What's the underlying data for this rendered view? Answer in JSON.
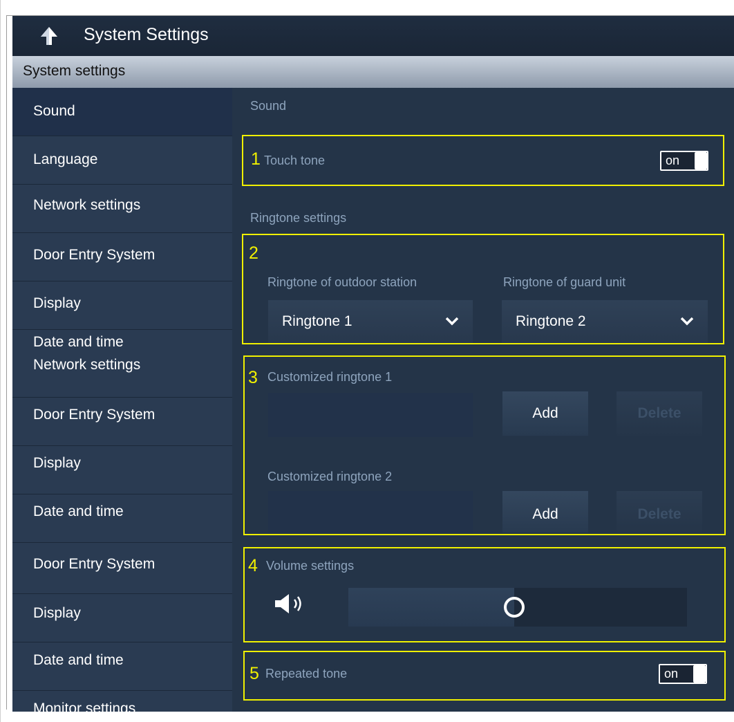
{
  "window": {
    "title": "System Settings"
  },
  "section_header": "System settings",
  "sidebar": {
    "block1": [
      "Sound",
      "Language",
      "Network settings",
      "Door Entry System",
      "Display",
      "Date and time"
    ],
    "block2": [
      "Network settings",
      "Door Entry System",
      "Display",
      "Date and time"
    ],
    "block3": [
      "Door Entry System",
      "Display",
      "Date and time",
      "Monitor settings"
    ]
  },
  "content": {
    "sound_heading": "Sound",
    "ringtone_heading": "Ringtone settings",
    "touch_tone": {
      "number": "1",
      "label": "Touch tone",
      "toggle": "on"
    },
    "ringtones": {
      "number": "2",
      "outdoor_label": "Ringtone of outdoor station",
      "outdoor_value": "Ringtone 1",
      "guard_label": "Ringtone of guard unit",
      "guard_value": "Ringtone 2"
    },
    "custom": {
      "number": "3",
      "ringtone1_label": "Customized ringtone 1",
      "ringtone2_label": "Customized ringtone 2",
      "add_label": "Add",
      "delete_label": "Delete"
    },
    "volume": {
      "number": "4",
      "label": "Volume settings",
      "level": 0.49
    },
    "repeated_tone": {
      "number": "5",
      "label": "Repeated tone",
      "toggle": "on"
    }
  },
  "icons": {
    "back": "back-arrow-icon",
    "volume": "speaker-icon",
    "dropdown": "chevron-down-icon"
  },
  "colors": {
    "highlight": "#f0f000",
    "background": "#243448",
    "muted_text": "#8ea4bd"
  }
}
